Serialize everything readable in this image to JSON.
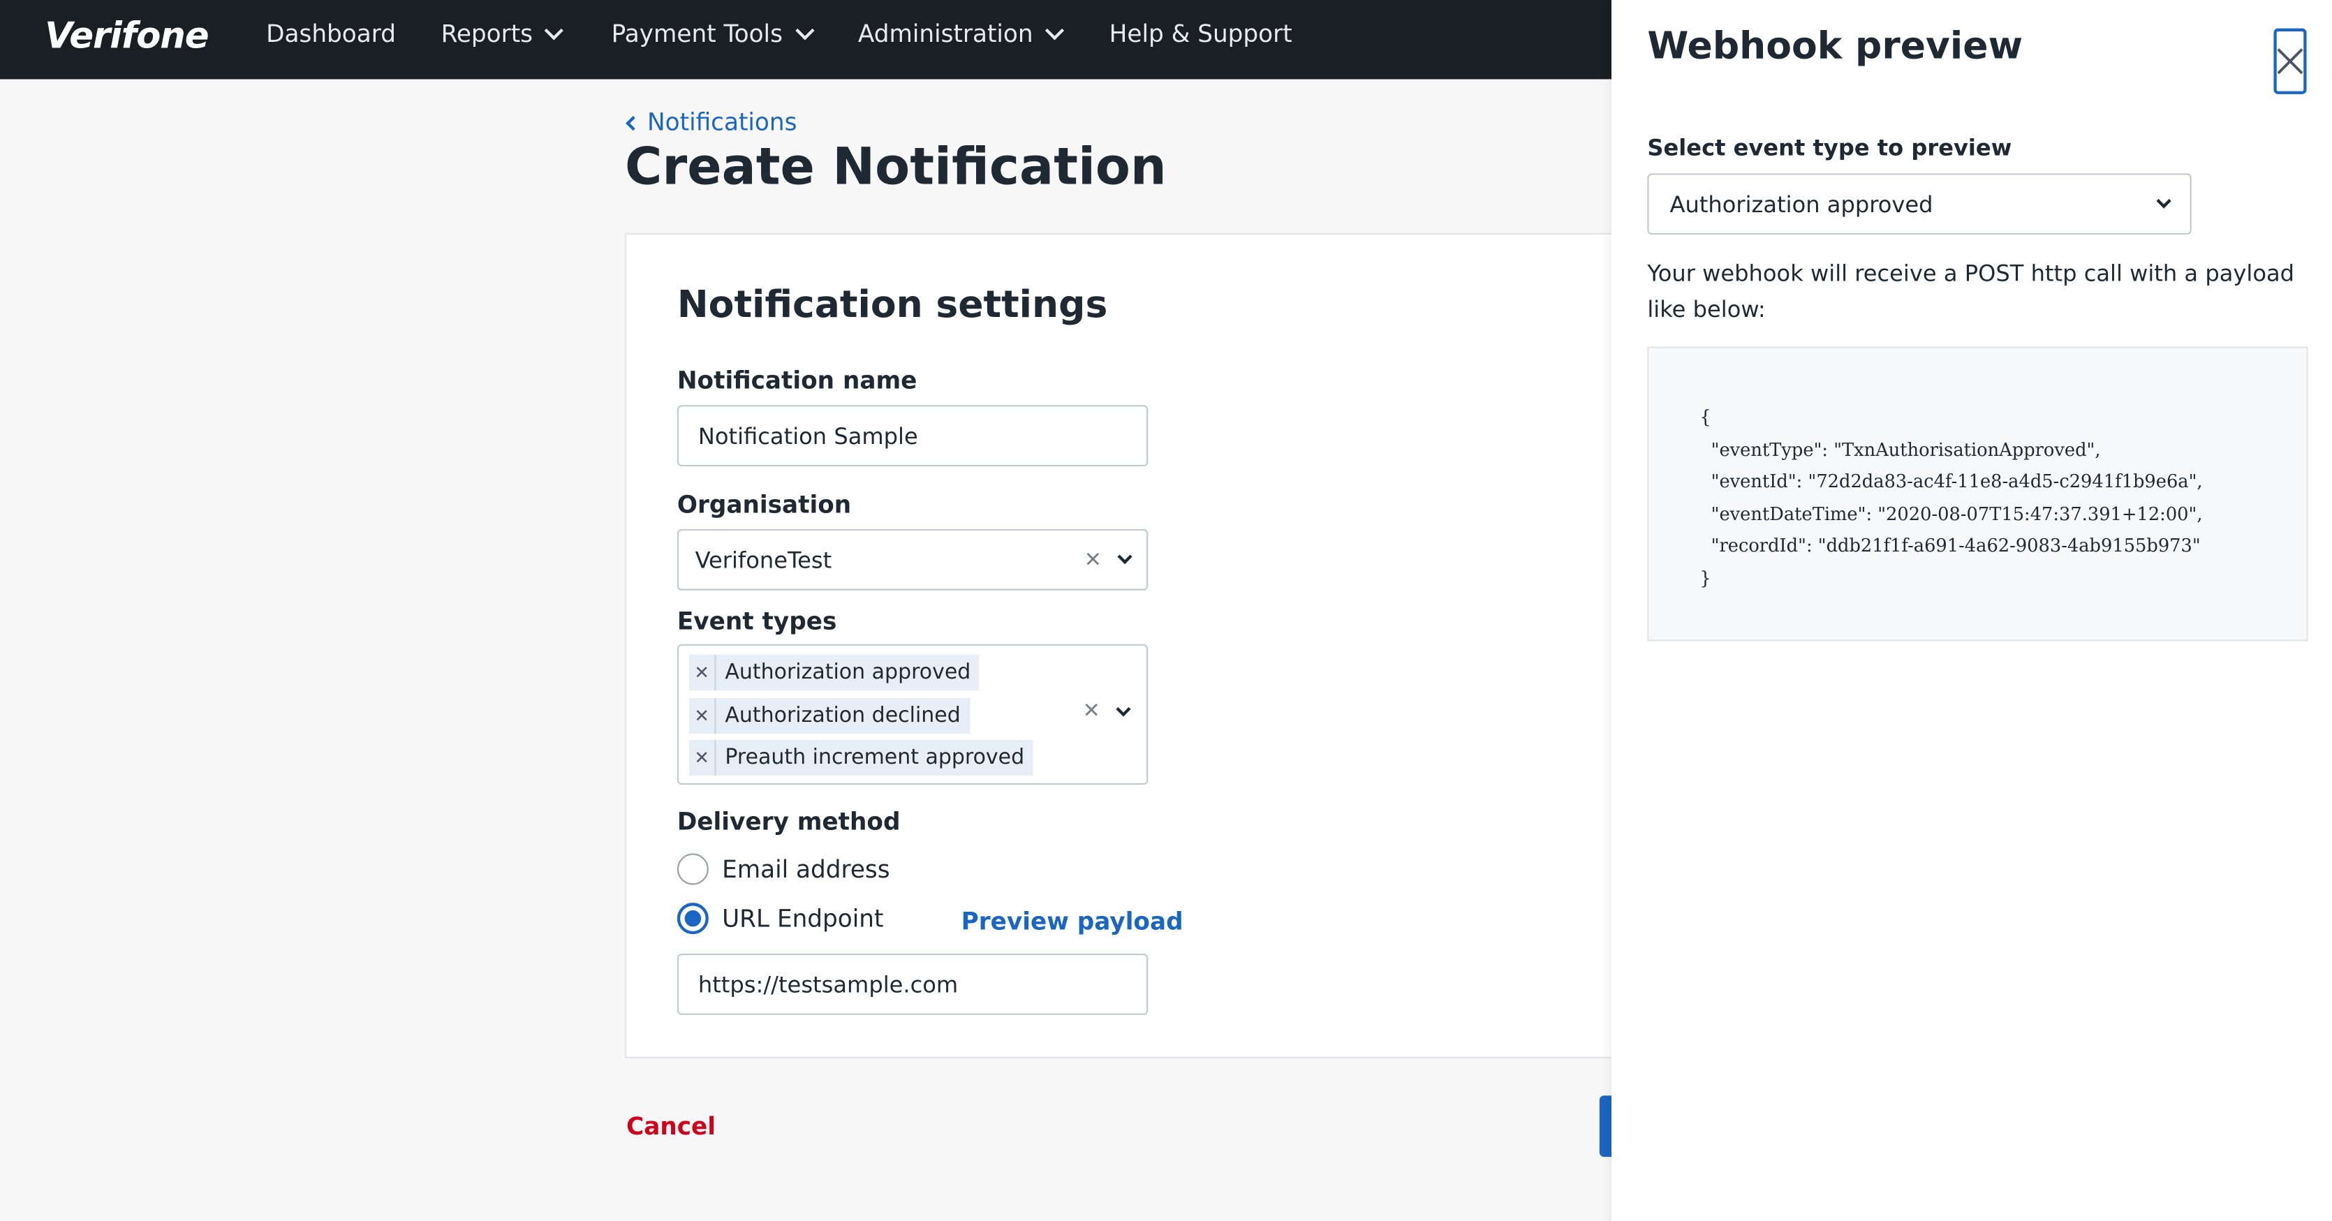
{
  "nav": {
    "logo": "Verifone",
    "items": [
      {
        "label": "Dashboard",
        "has_menu": false
      },
      {
        "label": "Reports",
        "has_menu": true
      },
      {
        "label": "Payment Tools",
        "has_menu": true
      },
      {
        "label": "Administration",
        "has_menu": true
      },
      {
        "label": "Help & Support",
        "has_menu": false
      }
    ]
  },
  "breadcrumb": {
    "label": "Notifications"
  },
  "page": {
    "title": "Create Notification"
  },
  "form": {
    "section_title": "Notification settings",
    "name": {
      "label": "Notification name",
      "value": "Notification Sample"
    },
    "organisation": {
      "label": "Organisation",
      "value": "VerifoneTest"
    },
    "event_types": {
      "label": "Event types",
      "selected": [
        "Authorization approved",
        "Authorization declined",
        "Preauth increment approved"
      ]
    },
    "delivery": {
      "label": "Delivery method",
      "options": [
        {
          "label": "Email address",
          "selected": false
        },
        {
          "label": "URL Endpoint",
          "selected": true
        }
      ],
      "preview_link": "Preview payload",
      "url_value": "https://testsample.com"
    },
    "cancel_label": "Cancel"
  },
  "drawer": {
    "title": "Webhook preview",
    "select_label": "Select event type to preview",
    "select_value": "Authorization approved",
    "description": "Your webhook will receive a POST http call with a payload like below:",
    "payload_lines": [
      "{",
      "  \"eventType\": \"TxnAuthorisationApproved\",",
      "  \"eventId\": \"72d2da83-ac4f-11e8-a4d5-c2941f1b9e6a\",",
      "  \"eventDateTime\": \"2020-08-07T15:47:37.391+12:00\",",
      "  \"recordId\": \"ddb21f1f-a691-4a62-9083-4ab9155b973\"",
      "}"
    ]
  },
  "colors": {
    "accent": "#1a66c2",
    "danger": "#d0021b",
    "nav_bg": "#1a1f24"
  },
  "icons": {
    "close": "close-icon",
    "dropdown": "chevron-down-icon",
    "back": "chevron-left-icon",
    "clear": "clear-icon"
  }
}
